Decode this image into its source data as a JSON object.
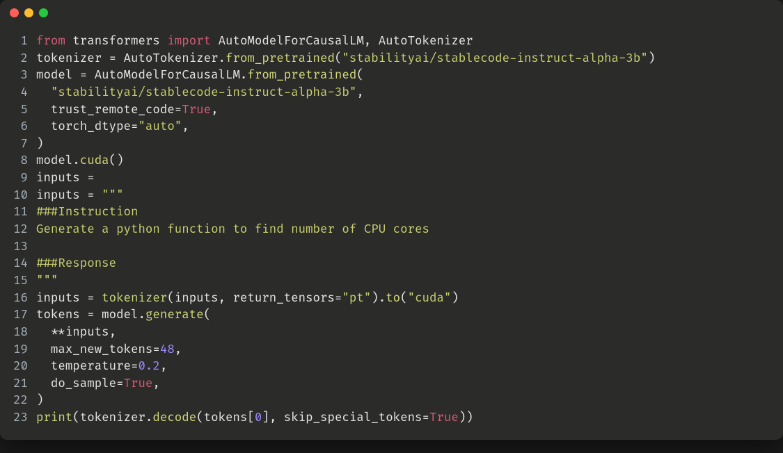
{
  "window": {
    "traffic_lights": [
      "close",
      "minimize",
      "maximize"
    ]
  },
  "code": {
    "lines": [
      {
        "n": 1,
        "tokens": [
          {
            "t": "from ",
            "c": "keyword"
          },
          {
            "t": "transformers ",
            "c": "default"
          },
          {
            "t": "import ",
            "c": "keyword"
          },
          {
            "t": "AutoModelForCausalLM, AutoTokenizer",
            "c": "default"
          }
        ]
      },
      {
        "n": 2,
        "tokens": [
          {
            "t": "tokenizer = AutoTokenizer.",
            "c": "default"
          },
          {
            "t": "from_pretrained",
            "c": "func"
          },
          {
            "t": "(",
            "c": "paren"
          },
          {
            "t": "\"stabilityai/stablecode-instruct-alpha-3b\"",
            "c": "string"
          },
          {
            "t": ")",
            "c": "paren"
          }
        ]
      },
      {
        "n": 3,
        "tokens": [
          {
            "t": "model = AutoModelForCausalLM.",
            "c": "default"
          },
          {
            "t": "from_pretrained",
            "c": "func"
          },
          {
            "t": "(",
            "c": "paren"
          }
        ]
      },
      {
        "n": 4,
        "tokens": [
          {
            "t": "  ",
            "c": "default"
          },
          {
            "t": "\"stabilityai/stablecode-instruct-alpha-3b\"",
            "c": "string"
          },
          {
            "t": ",",
            "c": "default"
          }
        ]
      },
      {
        "n": 5,
        "tokens": [
          {
            "t": "  trust_remote_code=",
            "c": "default"
          },
          {
            "t": "True",
            "c": "const"
          },
          {
            "t": ",",
            "c": "default"
          }
        ]
      },
      {
        "n": 6,
        "tokens": [
          {
            "t": "  torch_dtype=",
            "c": "default"
          },
          {
            "t": "\"auto\"",
            "c": "string"
          },
          {
            "t": ",",
            "c": "default"
          }
        ]
      },
      {
        "n": 7,
        "tokens": [
          {
            "t": ")",
            "c": "paren"
          }
        ]
      },
      {
        "n": 8,
        "tokens": [
          {
            "t": "model.",
            "c": "default"
          },
          {
            "t": "cuda",
            "c": "func"
          },
          {
            "t": "()",
            "c": "paren"
          }
        ]
      },
      {
        "n": 9,
        "tokens": [
          {
            "t": "inputs =",
            "c": "default"
          }
        ]
      },
      {
        "n": 10,
        "tokens": [
          {
            "t": "inputs = ",
            "c": "default"
          },
          {
            "t": "\"\"\"",
            "c": "string"
          }
        ]
      },
      {
        "n": 11,
        "tokens": [
          {
            "t": "###Instruction",
            "c": "string"
          }
        ]
      },
      {
        "n": 12,
        "tokens": [
          {
            "t": "Generate a python function to find number of CPU cores",
            "c": "string"
          }
        ]
      },
      {
        "n": 13,
        "tokens": [
          {
            "t": "",
            "c": "string"
          }
        ]
      },
      {
        "n": 14,
        "tokens": [
          {
            "t": "###Response",
            "c": "string"
          }
        ]
      },
      {
        "n": 15,
        "tokens": [
          {
            "t": "\"\"\"",
            "c": "string"
          }
        ]
      },
      {
        "n": 16,
        "tokens": [
          {
            "t": "inputs = ",
            "c": "default"
          },
          {
            "t": "tokenizer",
            "c": "builtin"
          },
          {
            "t": "(",
            "c": "paren"
          },
          {
            "t": "inputs, return_tensors=",
            "c": "default"
          },
          {
            "t": "\"pt\"",
            "c": "string"
          },
          {
            "t": ")",
            "c": "paren"
          },
          {
            "t": ".",
            "c": "default"
          },
          {
            "t": "to",
            "c": "func"
          },
          {
            "t": "(",
            "c": "paren"
          },
          {
            "t": "\"cuda\"",
            "c": "string"
          },
          {
            "t": ")",
            "c": "paren"
          }
        ]
      },
      {
        "n": 17,
        "tokens": [
          {
            "t": "tokens = model.",
            "c": "default"
          },
          {
            "t": "generate",
            "c": "func"
          },
          {
            "t": "(",
            "c": "paren"
          }
        ]
      },
      {
        "n": 18,
        "tokens": [
          {
            "t": "  **inputs,",
            "c": "default"
          }
        ]
      },
      {
        "n": 19,
        "tokens": [
          {
            "t": "  max_new_tokens=",
            "c": "default"
          },
          {
            "t": "48",
            "c": "number"
          },
          {
            "t": ",",
            "c": "default"
          }
        ]
      },
      {
        "n": 20,
        "tokens": [
          {
            "t": "  temperature=",
            "c": "default"
          },
          {
            "t": "0.2",
            "c": "number"
          },
          {
            "t": ",",
            "c": "default"
          }
        ]
      },
      {
        "n": 21,
        "tokens": [
          {
            "t": "  do_sample=",
            "c": "default"
          },
          {
            "t": "True",
            "c": "const"
          },
          {
            "t": ",",
            "c": "default"
          }
        ]
      },
      {
        "n": 22,
        "tokens": [
          {
            "t": ")",
            "c": "paren"
          }
        ]
      },
      {
        "n": 23,
        "tokens": [
          {
            "t": "print",
            "c": "builtin"
          },
          {
            "t": "(",
            "c": "paren"
          },
          {
            "t": "tokenizer.",
            "c": "default"
          },
          {
            "t": "decode",
            "c": "func"
          },
          {
            "t": "(",
            "c": "paren"
          },
          {
            "t": "tokens[",
            "c": "default"
          },
          {
            "t": "0",
            "c": "number"
          },
          {
            "t": "], skip_special_tokens=",
            "c": "default"
          },
          {
            "t": "True",
            "c": "const"
          },
          {
            "t": "))",
            "c": "paren"
          }
        ]
      }
    ]
  }
}
